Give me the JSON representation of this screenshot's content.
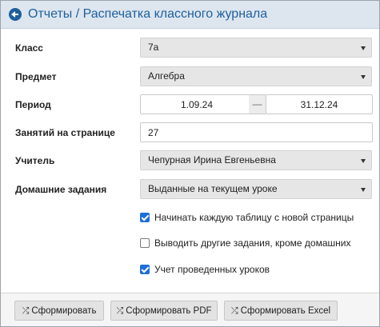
{
  "header": {
    "title": "Отчеты / Распечатка классного журнала",
    "back_icon": "arrow-left-circle-icon"
  },
  "fields": {
    "class": {
      "label": "Класс",
      "value": "7а"
    },
    "subject": {
      "label": "Предмет",
      "value": "Алгебра"
    },
    "period": {
      "label": "Период",
      "from": "1.09.24",
      "separator": "—",
      "to": "31.12.24"
    },
    "lessons_per_page": {
      "label": "Занятий на странице",
      "value": "27"
    },
    "teacher": {
      "label": "Учитель",
      "value": "Чепурная Ирина Евгеньевна"
    },
    "homework": {
      "label": "Домашние задания",
      "value": "Выданные на текущем уроке"
    }
  },
  "options": [
    {
      "label": "Начинать каждую таблицу с новой страницы",
      "checked": true
    },
    {
      "label": "Выводить другие задания, кроме домашних",
      "checked": false
    },
    {
      "label": "Учет проведенных уроков",
      "checked": true
    }
  ],
  "buttons": {
    "generate": "Сформировать",
    "generate_pdf": "Сформировать PDF",
    "generate_excel": "Сформировать Excel",
    "icon": "shuffle-icon"
  },
  "colors": {
    "header_bg": "#dde6ef",
    "accent": "#1f5f9c",
    "checkbox_checked": "#1e6fd8"
  }
}
